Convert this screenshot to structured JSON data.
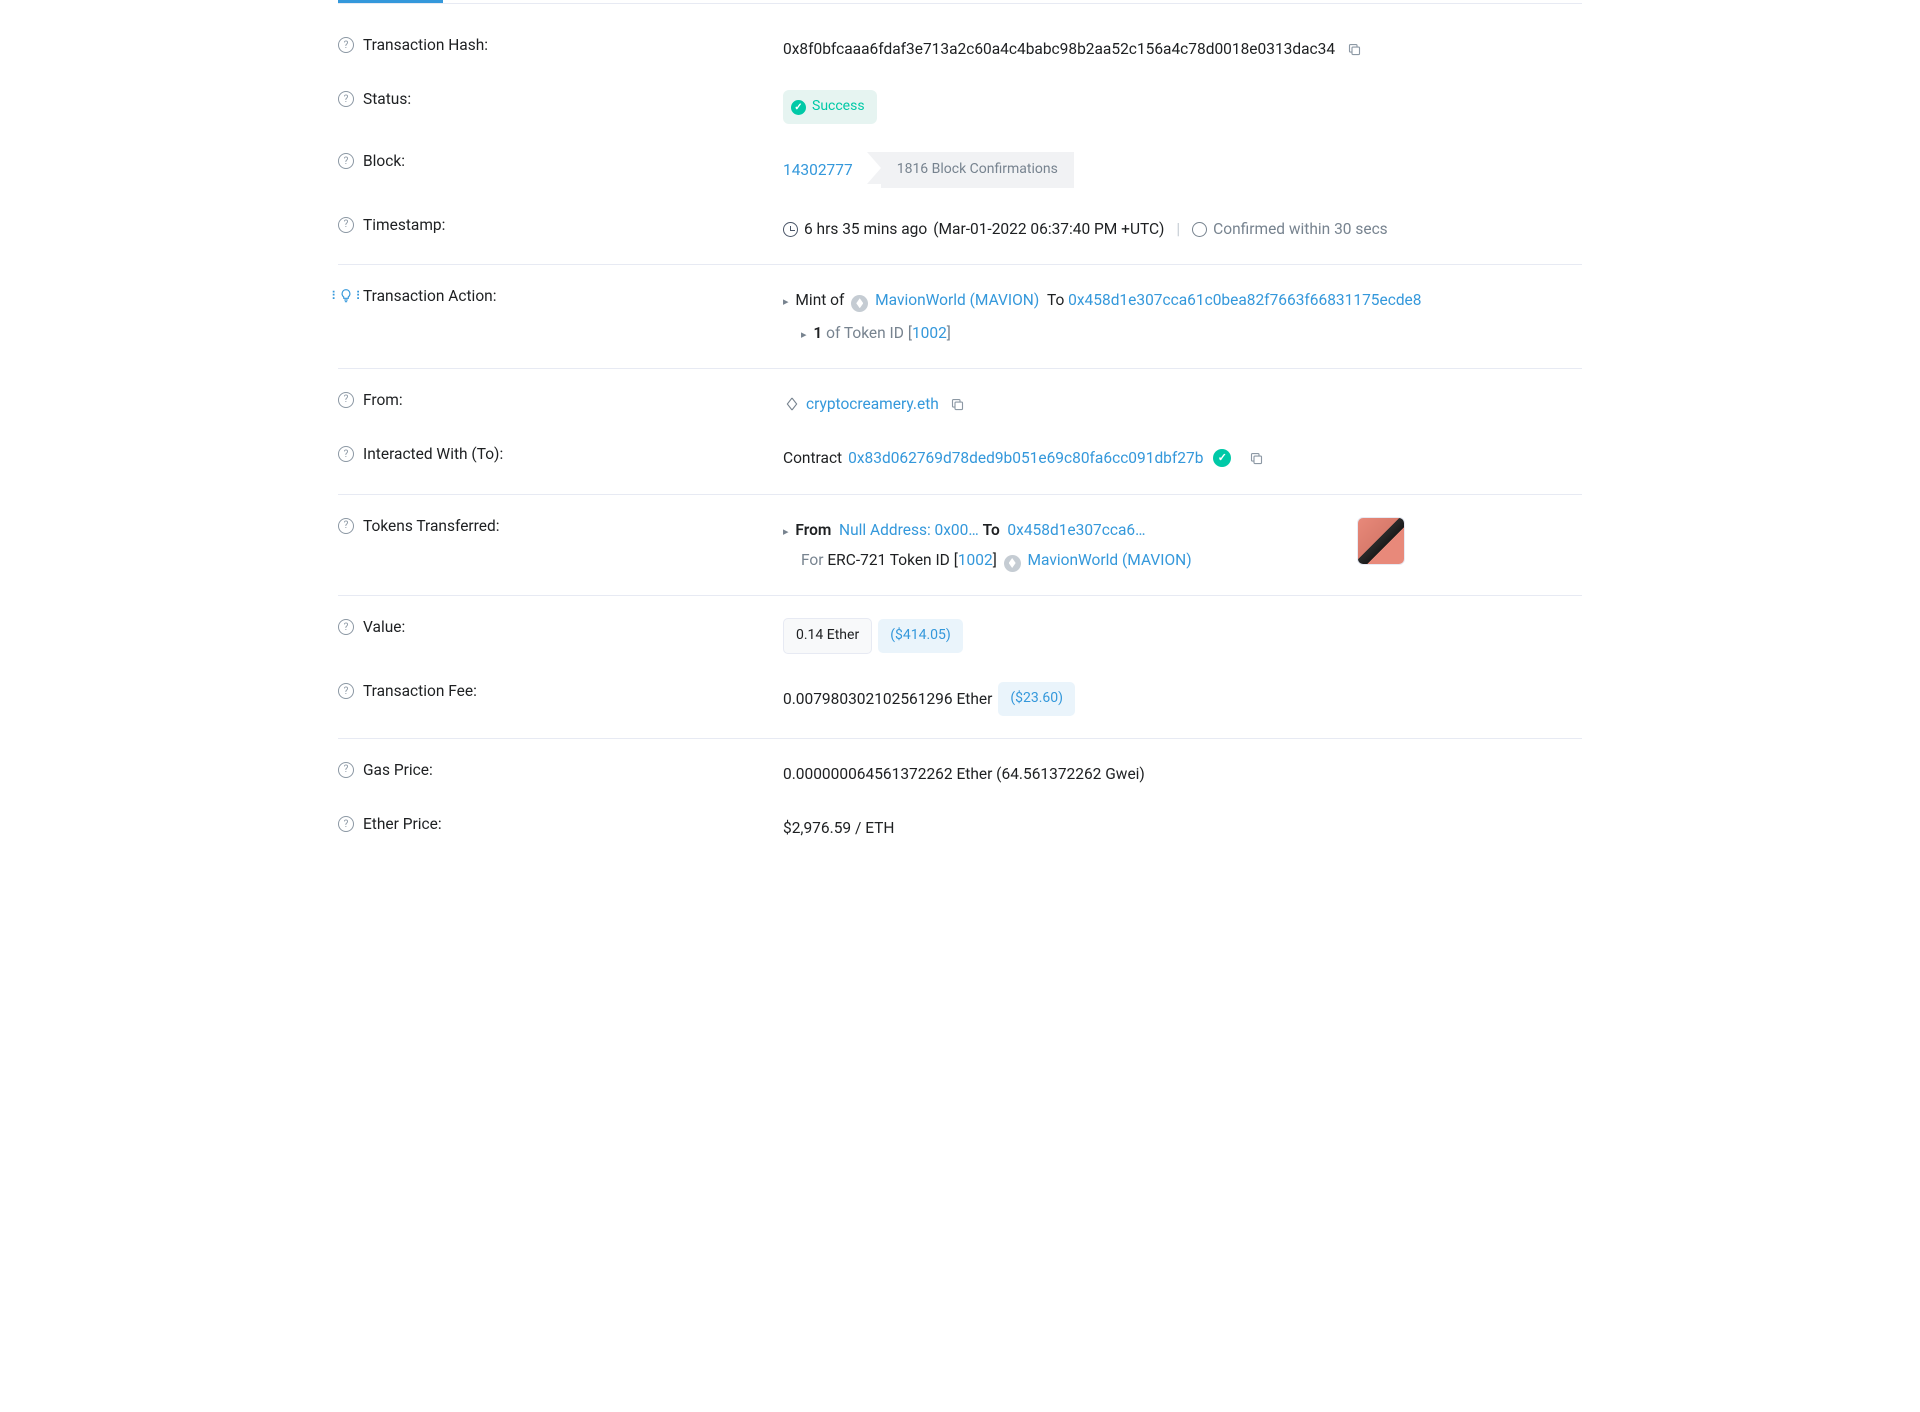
{
  "labels": {
    "txhash": "Transaction Hash:",
    "status": "Status:",
    "block": "Block:",
    "timestamp": "Timestamp:",
    "txaction": "Transaction Action:",
    "from": "From:",
    "to": "Interacted With (To):",
    "tokens": "Tokens Transferred:",
    "value": "Value:",
    "txfee": "Transaction Fee:",
    "gasprice": "Gas Price:",
    "ethprice": "Ether Price:"
  },
  "txhash": "0x8f0bfcaaa6fdaf3e713a2c60a4c4babc98b2aa52c156a4c78d0018e0313dac34",
  "status": "Success",
  "block": {
    "number": "14302777",
    "confirmations": "1816 Block Confirmations"
  },
  "timestamp": {
    "relative": "6 hrs 35 mins ago",
    "absolute": "(Mar-01-2022 06:37:40 PM +UTC)",
    "confirmed": "Confirmed within 30 secs"
  },
  "action": {
    "mint_prefix": "Mint of",
    "token_name": "MavionWorld (MAVION)",
    "to_label": "To",
    "to_address": "0x458d1e307cca61c0bea82f7663f66831175ecde8",
    "qty_prefix": "1",
    "of_label": "of",
    "tokenid_label": "Token ID",
    "tokenid": "1002"
  },
  "from": "cryptocreamery.eth",
  "to": {
    "contract_label": "Contract",
    "address": "0x83d062769d78ded9b051e69c80fa6cc091dbf27b"
  },
  "transfer": {
    "from_label": "From",
    "from_value": "Null Address: 0x00…",
    "to_label": "To",
    "to_value": "0x458d1e307cca6…",
    "for_label": "For",
    "standard": "ERC-721",
    "tokenid_label": "Token ID",
    "tokenid": "1002",
    "token_name": "MavionWorld (MAVION)"
  },
  "value": {
    "eth": "0.14 Ether",
    "usd": "($414.05)"
  },
  "txfee": {
    "eth": "0.007980302102561296 Ether",
    "usd": "($23.60)"
  },
  "gasprice": "0.000000064561372262 Ether (64.561372262 Gwei)",
  "ethprice": "$2,976.59 / ETH"
}
